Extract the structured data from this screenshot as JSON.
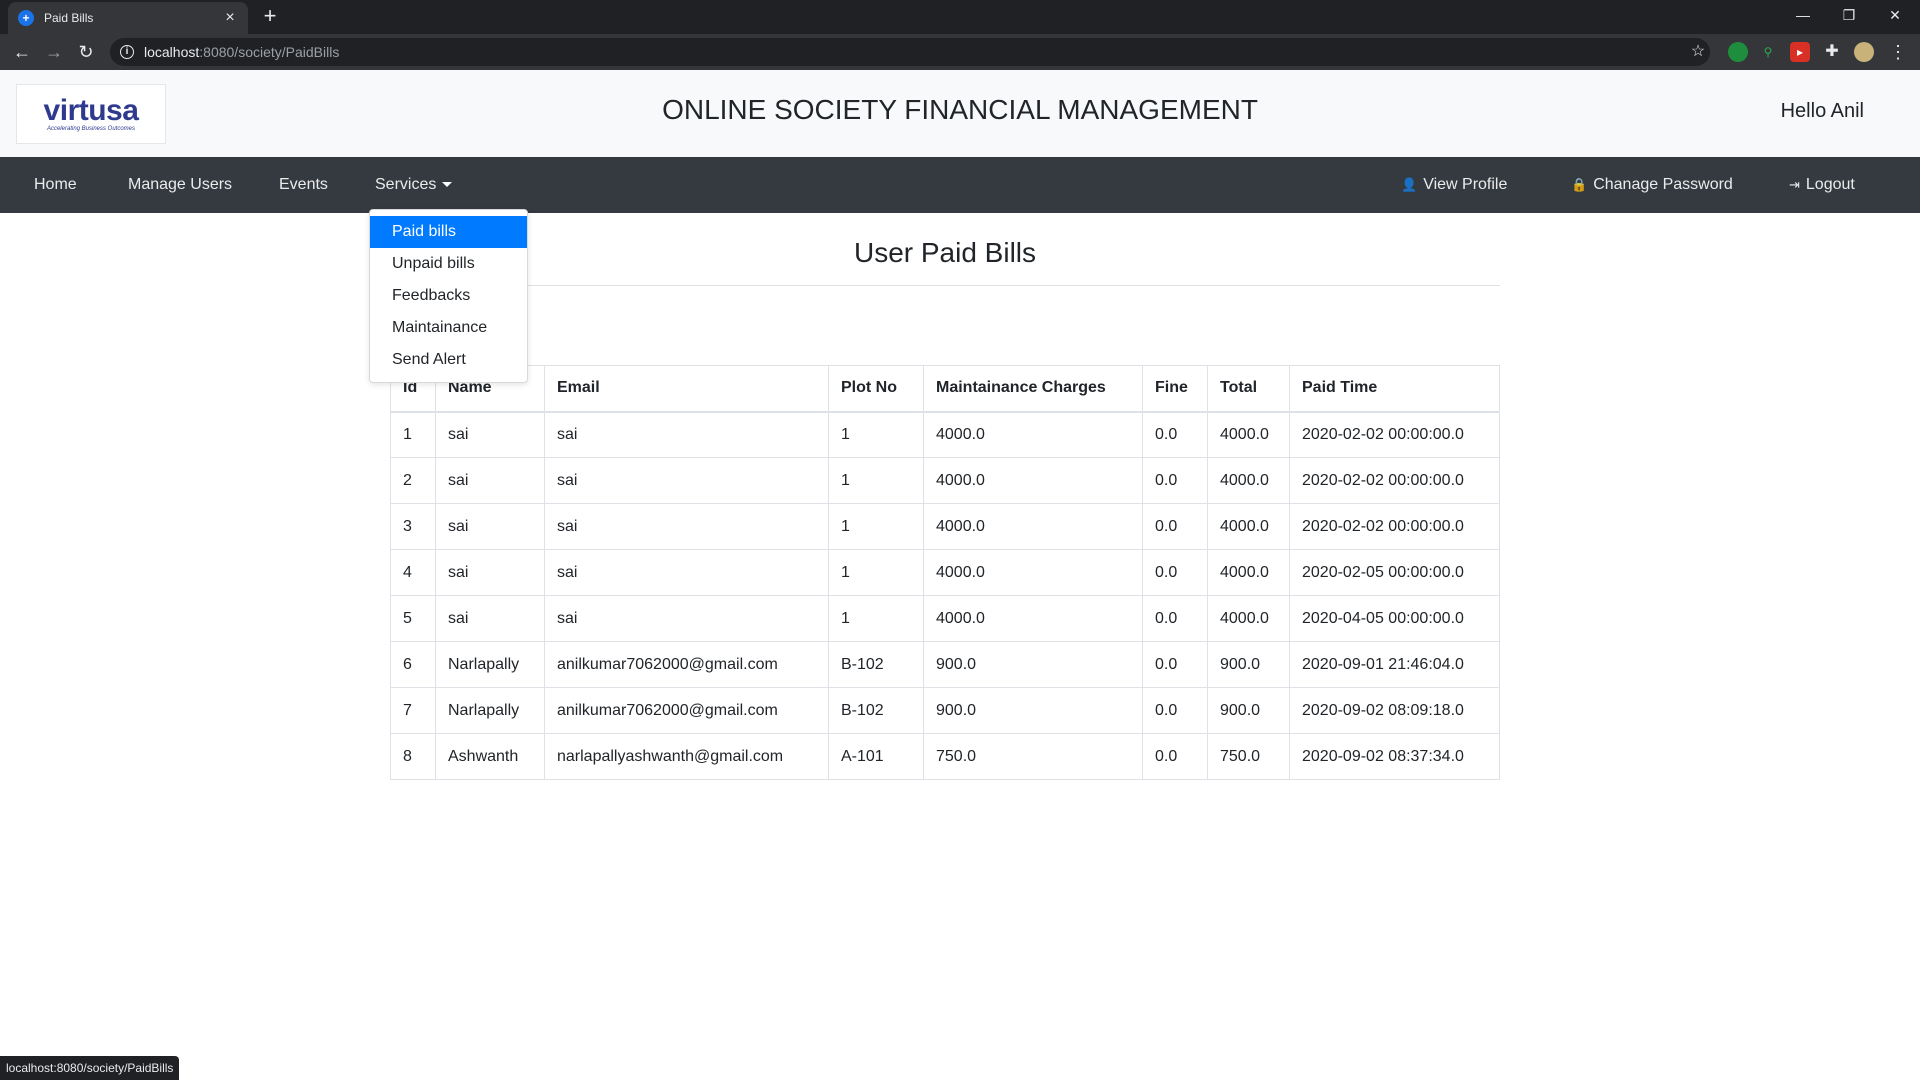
{
  "browser": {
    "tab_title": "Paid Bills",
    "tab_close": "×",
    "new_tab": "+",
    "url_host": "localhost",
    "url_rest": ":8080/society/PaidBills",
    "status_url": "localhost:8080/society/PaidBills",
    "back": "←",
    "forward": "→",
    "reload": "↻",
    "star": "☆",
    "minimize": "—",
    "restore": "❐",
    "close": "✕",
    "menu": "⋮"
  },
  "header": {
    "logo_word": "virtusa",
    "logo_tag": "Accelerating Business Outcomes",
    "title": "ONLINE SOCIETY FINANCIAL MANAGEMENT",
    "greeting": "Hello Anil"
  },
  "nav": {
    "home": "Home",
    "manage_users": "Manage Users",
    "events": "Events",
    "services": "Services",
    "view_profile": "View Profile",
    "change_password": "Chanage Password",
    "logout": "Logout"
  },
  "dropdown": {
    "items": [
      "Paid bills",
      "Unpaid bills",
      "Feedbacks",
      "Maintainance",
      "Send Alert"
    ]
  },
  "content": {
    "title": "User Paid Bills"
  },
  "table": {
    "headers": [
      "Id",
      "Name",
      "Email",
      "Plot No",
      "Maintainance Charges",
      "Fine",
      "Total",
      "Paid Time"
    ],
    "rows": [
      [
        "1",
        "sai",
        "sai",
        "1",
        "4000.0",
        "0.0",
        "4000.0",
        "2020-02-02 00:00:00.0"
      ],
      [
        "2",
        "sai",
        "sai",
        "1",
        "4000.0",
        "0.0",
        "4000.0",
        "2020-02-02 00:00:00.0"
      ],
      [
        "3",
        "sai",
        "sai",
        "1",
        "4000.0",
        "0.0",
        "4000.0",
        "2020-02-02 00:00:00.0"
      ],
      [
        "4",
        "sai",
        "sai",
        "1",
        "4000.0",
        "0.0",
        "4000.0",
        "2020-02-05 00:00:00.0"
      ],
      [
        "5",
        "sai",
        "sai",
        "1",
        "4000.0",
        "0.0",
        "4000.0",
        "2020-04-05 00:00:00.0"
      ],
      [
        "6",
        "Narlapally",
        "anilkumar7062000@gmail.com",
        "B-102",
        "900.0",
        "0.0",
        "900.0",
        "2020-09-01 21:46:04.0"
      ],
      [
        "7",
        "Narlapally",
        "anilkumar7062000@gmail.com",
        "B-102",
        "900.0",
        "0.0",
        "900.0",
        "2020-09-02 08:09:18.0"
      ],
      [
        "8",
        "Ashwanth",
        "narlapallyashwanth@gmail.com",
        "A-101",
        "750.0",
        "0.0",
        "750.0",
        "2020-09-02 08:37:34.0"
      ]
    ]
  }
}
